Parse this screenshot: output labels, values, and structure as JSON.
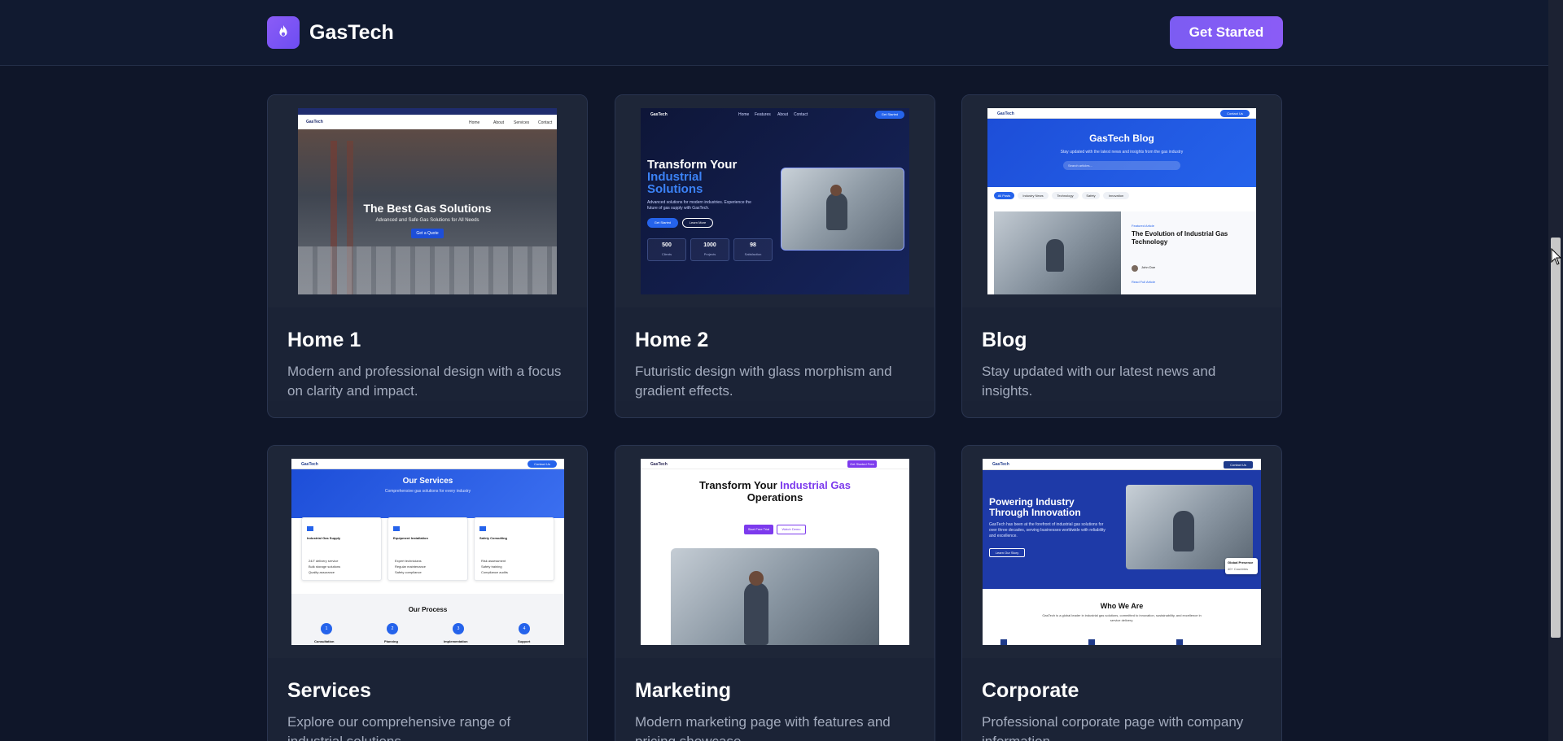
{
  "nav": {
    "brand_name": "GasTech",
    "cta_label": "Get Started"
  },
  "colors": {
    "background": "#0f1629",
    "card": "#1a2235",
    "accent": "#7c5cf2",
    "text_muted": "#a3abbd"
  },
  "templates": [
    {
      "title": "Home 1",
      "description": "Modern and professional design with a focus on clarity and impact.",
      "preview": {
        "brand": "GasTech",
        "headline": "The Best Gas Solutions",
        "subline": "Advanced and Safe Gas Solutions for All Needs",
        "button": "Get a Quote",
        "nav": [
          "Home",
          "About",
          "Services",
          "Contact"
        ]
      }
    },
    {
      "title": "Home 2",
      "description": "Futuristic design with glass morphism and gradient effects.",
      "preview": {
        "brand": "GasTech",
        "headline_1": "Transform Your",
        "headline_2": "Industrial",
        "headline_3": "Solutions",
        "subline": "Advanced solutions for modern industries. Experience the future of gas supply with GasTech.",
        "btn_primary": "Get Started",
        "btn_secondary": "Learn More",
        "stats": [
          {
            "value": "500",
            "label": "Clients"
          },
          {
            "value": "1000",
            "label": "Projects"
          },
          {
            "value": "98",
            "label": "Satisfaction"
          }
        ],
        "nav_btn": "Get Started",
        "nav": [
          "Home",
          "Features",
          "About",
          "Contact"
        ]
      }
    },
    {
      "title": "Blog",
      "description": "Stay updated with our latest news and insights.",
      "preview": {
        "brand": "GasTech",
        "headline": "GasTech Blog",
        "subline": "Stay updated with the latest news and insights from the gas industry",
        "search_placeholder": "Search articles...",
        "filters": [
          "All Posts",
          "Industry News",
          "Technology",
          "Safety",
          "Innovation"
        ],
        "article_tag": "Featured Article",
        "article_title": "The Evolution of Industrial Gas Technology",
        "article_author": "John Doe",
        "read_more": "Read Full Article",
        "nav_btn": "Contact Us"
      }
    },
    {
      "title": "Services",
      "description": "Explore our comprehensive range of industrial solutions",
      "preview": {
        "brand": "GasTech",
        "headline": "Our Services",
        "subline": "Comprehensive gas solutions for every industry",
        "services": [
          {
            "name": "Industrial Gas Supply",
            "items": [
              "24/7 delivery service",
              "Bulk storage solutions",
              "Quality assurance"
            ]
          },
          {
            "name": "Equipment Installation",
            "items": [
              "Expert technicians",
              "Regular maintenance",
              "Safety compliance"
            ]
          },
          {
            "name": "Safety Consulting",
            "items": [
              "Risk assessment",
              "Safety training",
              "Compliance audits"
            ]
          }
        ],
        "process_title": "Our Process",
        "steps": [
          "Consultation",
          "Planning",
          "Implementation",
          "Support"
        ],
        "nav_btn": "Contact Us"
      }
    },
    {
      "title": "Marketing",
      "description": "Modern marketing page with features and pricing showcase",
      "preview": {
        "brand": "GasTech",
        "headline_1": "Transform Your ",
        "headline_accent": "Industrial Gas",
        "headline_2": "Operations",
        "btn_primary": "Start Free Trial",
        "btn_secondary": "Watch Demo",
        "nav_btn": "Get Started Free"
      }
    },
    {
      "title": "Corporate",
      "description": "Professional corporate page with company information",
      "preview": {
        "brand": "GasTech",
        "headline": "Powering Industry Through Innovation",
        "subline": "GasTech has been at the forefront of industrial gas solutions for over three decades, serving businesses worldwide with reliability and excellence.",
        "button": "Learn Our Story",
        "badge_title": "Global Presence",
        "badge_value": "40+ Countries",
        "section_title": "Who We Are",
        "section_text": "GasTech is a global leader in industrial gas solutions, committed to innovation, sustainability, and excellence in service delivery.",
        "nav_btn": "Contact Us"
      }
    }
  ]
}
